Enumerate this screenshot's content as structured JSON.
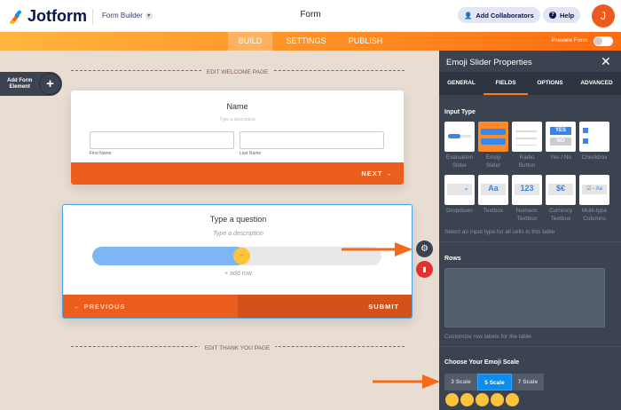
{
  "header": {
    "brand": "Jotform",
    "builder_menu": "Form Builder",
    "form_title": "Form",
    "add_collaborators": "Add Collaborators",
    "help": "Help",
    "avatar_initial": "J"
  },
  "nav": {
    "tabs": [
      "BUILD",
      "SETTINGS",
      "PUBLISH"
    ],
    "active": "BUILD",
    "preview_form": "Preview Form"
  },
  "canvas": {
    "add_element_line1": "Add Form",
    "add_element_line2": "Element",
    "welcome_label": "EDIT WELCOME PAGE",
    "welcome_card": {
      "title": "Name",
      "description": "Type a description",
      "first_name": "First Name",
      "last_name": "Last Name",
      "next": "NEXT"
    },
    "question_card": {
      "title": "Type a question",
      "description": "Type a description",
      "add_row": "+ add row",
      "previous": "PREVIOUS",
      "submit": "SUBMIT",
      "slider_value_fraction": 0.5
    },
    "thankyou_label": "EDIT THANK YOU PAGE"
  },
  "panel": {
    "title": "Emoji Slider Properties",
    "tabs": [
      "GENERAL",
      "FIELDS",
      "OPTIONS",
      "ADVANCED"
    ],
    "active_tab": "FIELDS",
    "input_type_label": "Input Type",
    "input_types": [
      {
        "line1": "Evaluation",
        "line2": "Slider"
      },
      {
        "line1": "Emoji",
        "line2": "Slider"
      },
      {
        "line1": "Radio",
        "line2": "Button"
      },
      {
        "line1": "Yes / No",
        "line2": ""
      },
      {
        "line1": "Checkbox",
        "line2": ""
      },
      {
        "line1": "Dropdown",
        "line2": ""
      },
      {
        "line1": "Textbox",
        "line2": ""
      },
      {
        "line1": "Numeric",
        "line2": "Textbox"
      },
      {
        "line1": "Currency",
        "line2": "Textbox"
      },
      {
        "line1": "Multi-type",
        "line2": "Columns"
      }
    ],
    "tile_text": {
      "yes": "YES",
      "no": "NO",
      "aa": "Aa",
      "num": "123",
      "cur": "$€"
    },
    "input_type_hint": "Select an input type for all cells in this table",
    "rows_label": "Rows",
    "rows_value": "",
    "rows_hint": "Customize row labels for the table",
    "emoji_scale_label": "Choose Your Emoji Scale",
    "scales": [
      "3 Scale",
      "5 Scale",
      "7 Scale"
    ],
    "active_scale": "5 Scale"
  },
  "colors": {
    "orange": "#ec5e1e",
    "panel": "#3c4350",
    "active_blue": "#0a8cf0",
    "slider_blue": "#7eb5f5"
  }
}
